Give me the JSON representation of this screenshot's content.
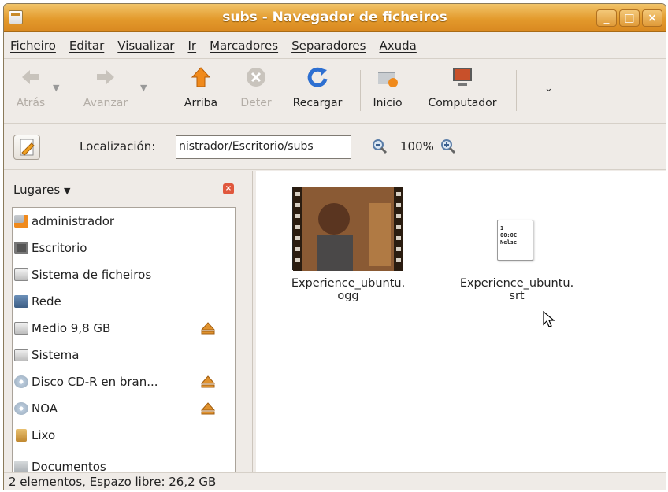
{
  "window": {
    "title": "subs - Navegador de ficheiros"
  },
  "menubar": {
    "items": [
      "Ficheiro",
      "Editar",
      "Visualizar",
      "Ir",
      "Marcadores",
      "Separadores",
      "Axuda"
    ]
  },
  "toolbar": {
    "back": "Atrás",
    "forward": "Avanzar",
    "up": "Arriba",
    "stop": "Deter",
    "reload": "Recargar",
    "home": "Inicio",
    "computer": "Computador"
  },
  "location": {
    "label": "Localización:",
    "value": "nistrador/Escritorio/subs",
    "zoom": "100%"
  },
  "sidebar": {
    "title": "Lugares",
    "items": [
      {
        "label": "administrador",
        "icon": "home-folder-icon",
        "eject": false
      },
      {
        "label": "Escritorio",
        "icon": "desktop-icon",
        "eject": false
      },
      {
        "label": "Sistema de ficheiros",
        "icon": "filesystem-icon",
        "eject": false
      },
      {
        "label": "Rede",
        "icon": "network-icon",
        "eject": false
      },
      {
        "label": "Medio 9,8 GB",
        "icon": "drive-icon",
        "eject": true
      },
      {
        "label": "Sistema",
        "icon": "drive-icon",
        "eject": false
      },
      {
        "label": "Disco CD-R en bran...",
        "icon": "cdrom-icon",
        "eject": true
      },
      {
        "label": "NOA",
        "icon": "cdrom-icon",
        "eject": true
      },
      {
        "label": "Lixo",
        "icon": "trash-icon",
        "eject": false
      },
      {
        "label": "Documentos",
        "icon": "folder-icon",
        "eject": false
      }
    ]
  },
  "files": [
    {
      "line1": "Experience_ubuntu.",
      "line2": "ogg",
      "type": "video"
    },
    {
      "line1": "Experience_ubuntu.",
      "line2": "srt",
      "type": "subtitle",
      "preview": [
        "1",
        "00:0C",
        "Nelsc"
      ]
    }
  ],
  "status": "2 elementos, Espazo libre: 26,2 GB",
  "colors": {
    "titlebar": "#e39a2c",
    "window_bg": "#efebe7"
  }
}
